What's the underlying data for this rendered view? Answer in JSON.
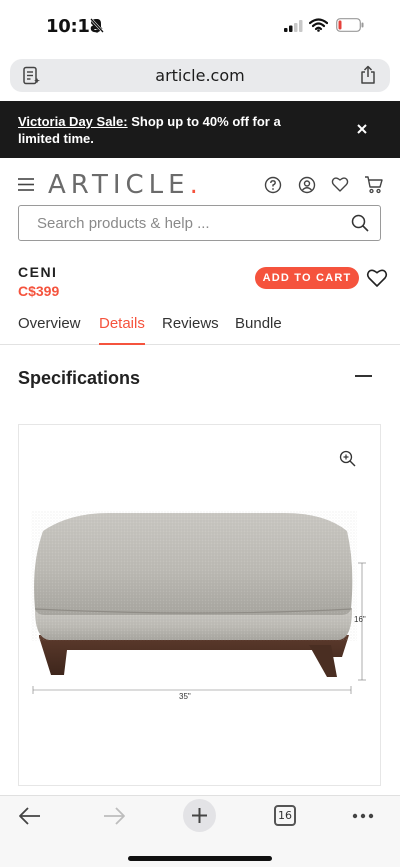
{
  "status_bar": {
    "time": "10:18"
  },
  "browser": {
    "url": "article.com",
    "open_tabs_count": "16"
  },
  "promo": {
    "link_text": "Victoria Day Sale:",
    "message": " Shop up to 40% off for a limited time."
  },
  "header": {
    "logo_text": "ARTICLE",
    "logo_dot": ".",
    "icons": [
      "menu-icon",
      "help-icon",
      "account-icon",
      "heart-icon",
      "cart-icon"
    ]
  },
  "search": {
    "placeholder": "Search products & help ..."
  },
  "product": {
    "name": "CENI",
    "price": "C$399",
    "add_to_cart_label": "ADD TO CART"
  },
  "tabs": [
    {
      "label": "Overview",
      "active": false
    },
    {
      "label": "Details",
      "active": true
    },
    {
      "label": "Reviews",
      "active": false
    },
    {
      "label": "Bundle",
      "active": false
    }
  ],
  "specifications": {
    "title": "Specifications",
    "height_label": "16\"",
    "width_label": "35\""
  },
  "colors": {
    "accent": "#f5533d",
    "banner_bg": "#1a1a1a"
  }
}
